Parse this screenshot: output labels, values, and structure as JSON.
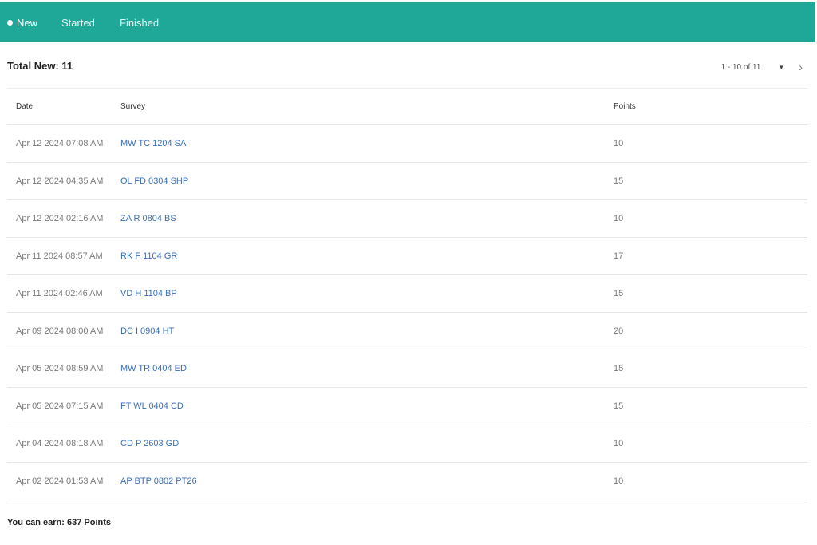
{
  "tabs": [
    {
      "label": "New"
    },
    {
      "label": "Started"
    },
    {
      "label": "Finished"
    }
  ],
  "summary": {
    "total_label": "Total New: 11"
  },
  "pager": {
    "range": "1 - 10 of 11"
  },
  "table": {
    "headers": {
      "date": "Date",
      "survey": "Survey",
      "points": "Points"
    },
    "rows": [
      {
        "date": "Apr 12 2024 07:08 AM",
        "survey": "MW TC 1204 SA",
        "points": "10"
      },
      {
        "date": "Apr 12 2024 04:35 AM",
        "survey": "OL FD 0304 SHP",
        "points": "15"
      },
      {
        "date": "Apr 12 2024 02:16 AM",
        "survey": "ZA R 0804 BS",
        "points": "10"
      },
      {
        "date": "Apr 11 2024 08:57 AM",
        "survey": "RK F 1104 GR",
        "points": "17"
      },
      {
        "date": "Apr 11 2024 02:46 AM",
        "survey": "VD H 1104 BP",
        "points": "15"
      },
      {
        "date": "Apr 09 2024 08:00 AM",
        "survey": "DC I 0904 HT",
        "points": "20"
      },
      {
        "date": "Apr 05 2024 08:59 AM",
        "survey": "MW TR 0404 ED",
        "points": "15"
      },
      {
        "date": "Apr 05 2024 07:15 AM",
        "survey": "FT WL 0404 CD",
        "points": "15"
      },
      {
        "date": "Apr 04 2024 08:18 AM",
        "survey": "CD P 2603 GD",
        "points": "10"
      },
      {
        "date": "Apr 02 2024 01:53 AM",
        "survey": "AP BTP 0802 PT26",
        "points": "10"
      }
    ]
  },
  "footer": {
    "earn_label": "You can earn: 637 Points"
  },
  "colors": {
    "brand": "#1fa798",
    "link": "#3a6fb5"
  }
}
